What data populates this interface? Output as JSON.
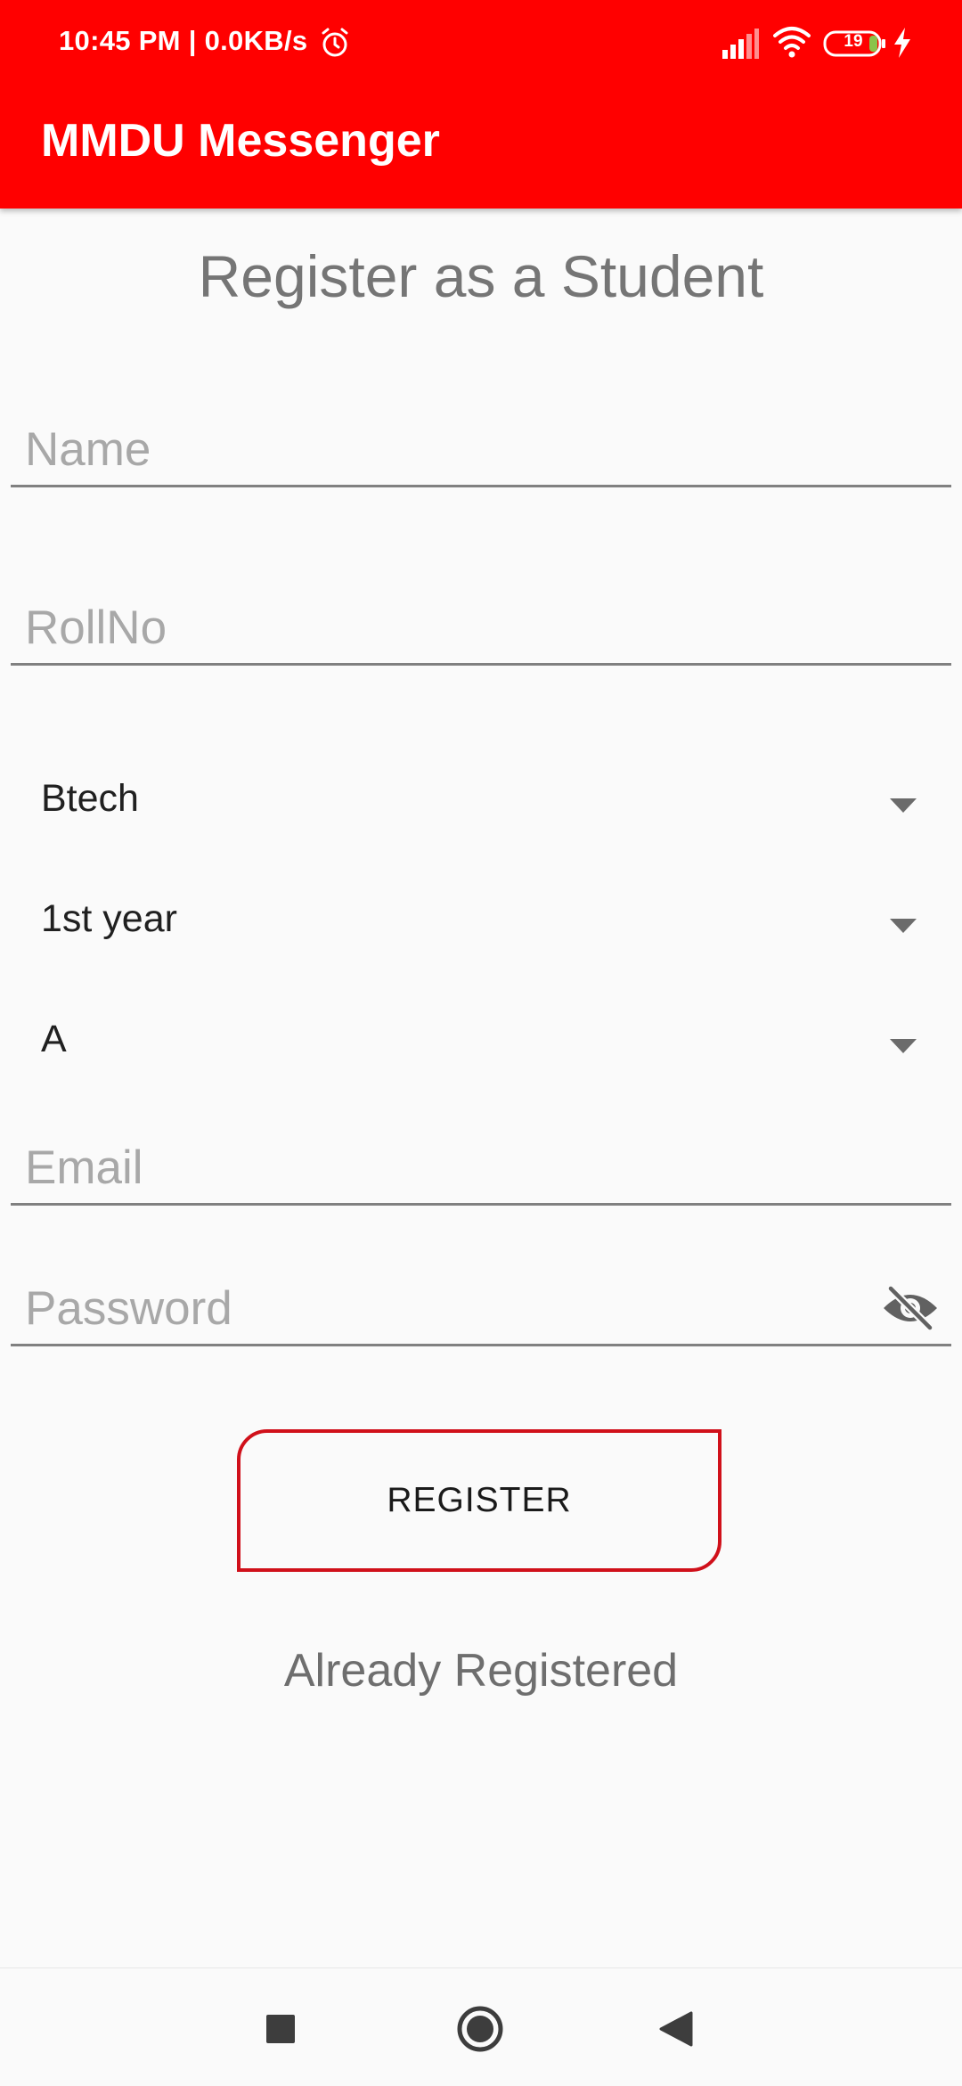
{
  "status_bar": {
    "time_text": "10:45 PM | 0.0KB/s",
    "battery_level": "19",
    "icons": [
      "alarm-icon",
      "signal-icon",
      "wifi-icon",
      "battery-icon",
      "charging-icon"
    ]
  },
  "app_bar": {
    "title": "MMDU Messenger",
    "color": "#ff0000"
  },
  "form": {
    "heading": "Register as a Student",
    "name_placeholder": "Name",
    "rollno_placeholder": "RollNo",
    "course_selected": "Btech",
    "year_selected": "1st year",
    "section_selected": "A",
    "email_placeholder": "Email",
    "password_placeholder": "Password",
    "password_toggle_icon": "eye-off-icon",
    "register_label": "REGISTER",
    "register_border_color": "#d0101a",
    "already_registered_link": "Already Registered"
  },
  "nav_bar": {
    "buttons": [
      "recents-icon",
      "home-icon",
      "back-icon"
    ]
  }
}
